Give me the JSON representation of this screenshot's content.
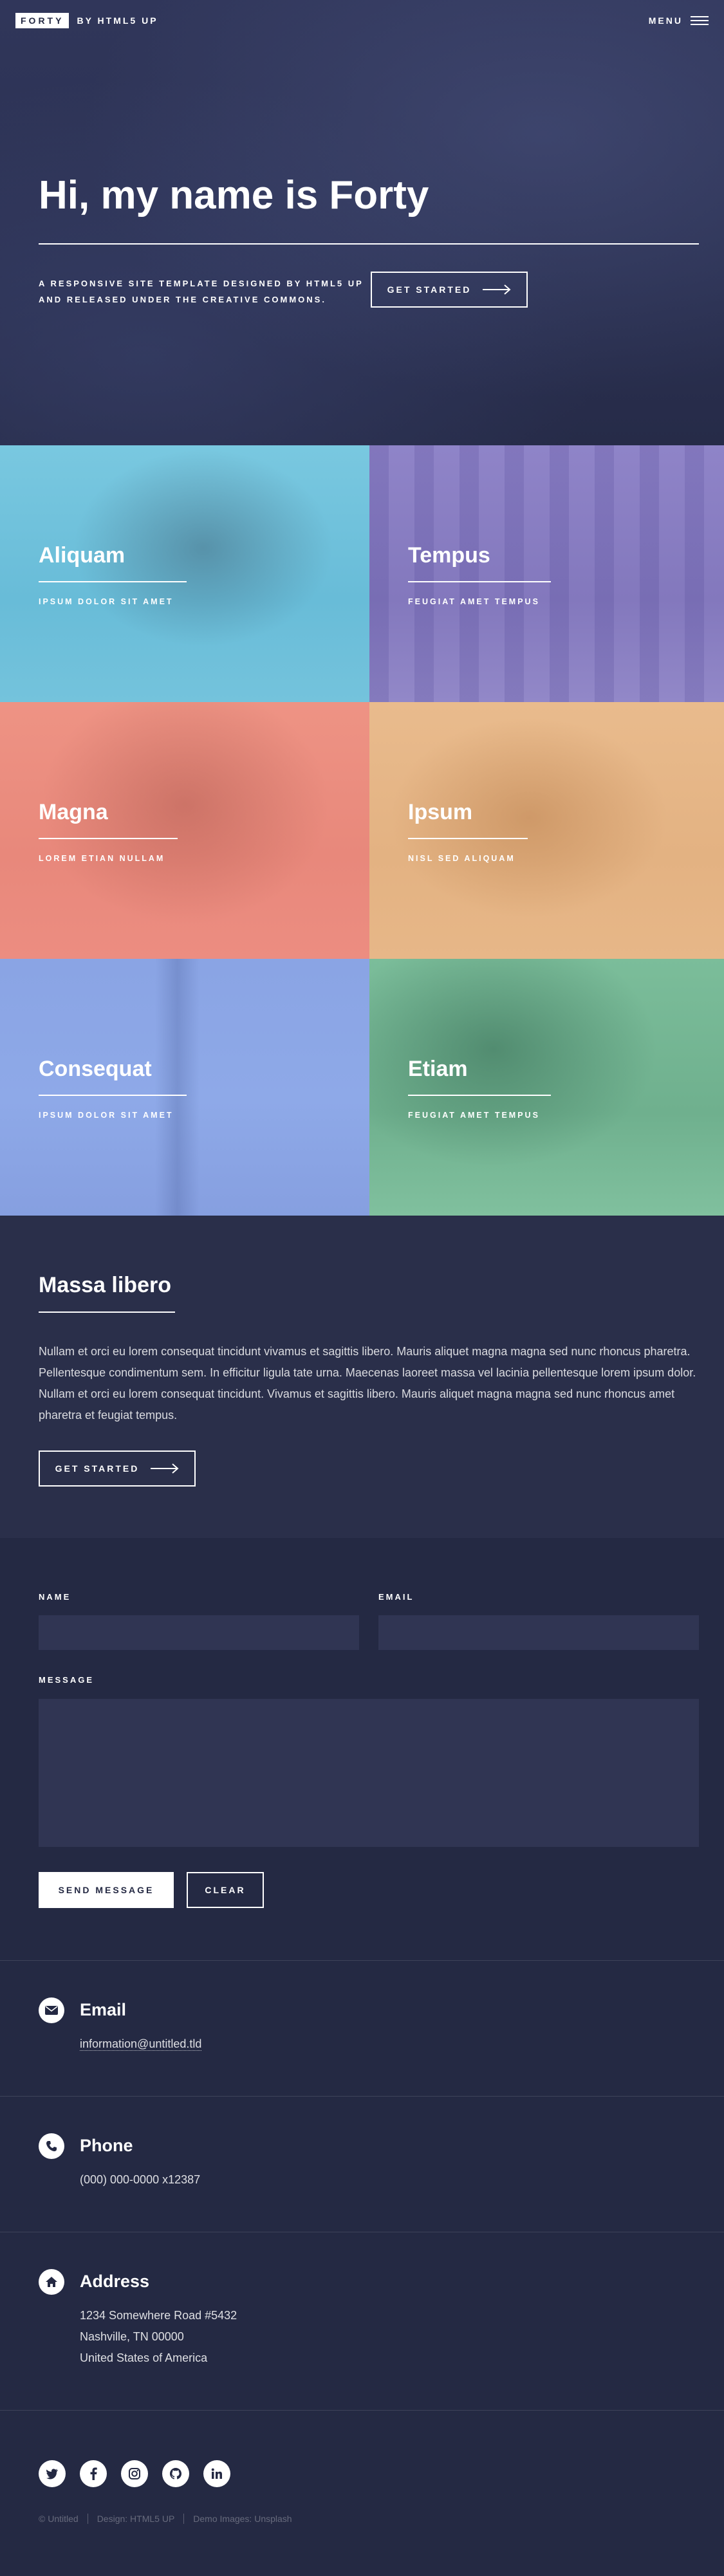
{
  "header": {
    "logo_box": "FORTY",
    "logo_by": "BY HTML5 UP",
    "menu_label": "MENU"
  },
  "banner": {
    "title": "Hi, my name is Forty",
    "subtitle_line1": "A RESPONSIVE SITE TEMPLATE DESIGNED BY HTML5 UP",
    "subtitle_line2": "AND RELEASED UNDER THE CREATIVE COMMONS.",
    "button_label": "GET STARTED"
  },
  "tiles": [
    {
      "title": "Aliquam",
      "subtitle": "IPSUM DOLOR SIT AMET",
      "color": "#6fc3df"
    },
    {
      "title": "Tempus",
      "subtitle": "FEUGIAT AMET TEMPUS",
      "color": "#8d82c4"
    },
    {
      "title": "Magna",
      "subtitle": "LOREM ETIAN NULLAM",
      "color": "#ec8d81"
    },
    {
      "title": "Ipsum",
      "subtitle": "NISL SED ALIQUAM",
      "color": "#e7b788"
    },
    {
      "title": "Consequat",
      "subtitle": "IPSUM DOLOR SIT AMET",
      "color": "#8ea9e8"
    },
    {
      "title": "Etiam",
      "subtitle": "FEUGIAT AMET TEMPUS",
      "color": "#87c5a4"
    }
  ],
  "intro": {
    "title": "Massa libero",
    "text": "Nullam et orci eu lorem consequat tincidunt vivamus et sagittis libero. Mauris aliquet magna magna sed nunc rhoncus pharetra. Pellentesque condimentum sem. In efficitur ligula tate urna. Maecenas laoreet massa vel lacinia pellentesque lorem ipsum dolor. Nullam et orci eu lorem consequat tincidunt. Vivamus et sagittis libero. Mauris aliquet magna magna sed nunc rhoncus amet pharetra et feugiat tempus.",
    "button_label": "GET STARTED"
  },
  "form": {
    "name_label": "NAME",
    "email_label": "EMAIL",
    "message_label": "MESSAGE",
    "send_label": "SEND MESSAGE",
    "clear_label": "CLEAR"
  },
  "contact": {
    "email_title": "Email",
    "email_value": "information@untitled.tld",
    "phone_title": "Phone",
    "phone_value": "(000) 000-0000 x12387",
    "address_title": "Address",
    "address_line1": "1234 Somewhere Road #5432",
    "address_line2": "Nashville, TN 00000",
    "address_line3": "United States of America"
  },
  "footer": {
    "social_icons": [
      "twitter-icon",
      "facebook-icon",
      "instagram-icon",
      "github-icon",
      "linkedin-icon"
    ],
    "copyright": [
      "© Untitled",
      "Design: HTML5 UP",
      "Demo Images: Unsplash"
    ]
  },
  "colors": {
    "background": "#242943",
    "section_alt": "#2a2f4a",
    "input_bg": "#303553"
  }
}
